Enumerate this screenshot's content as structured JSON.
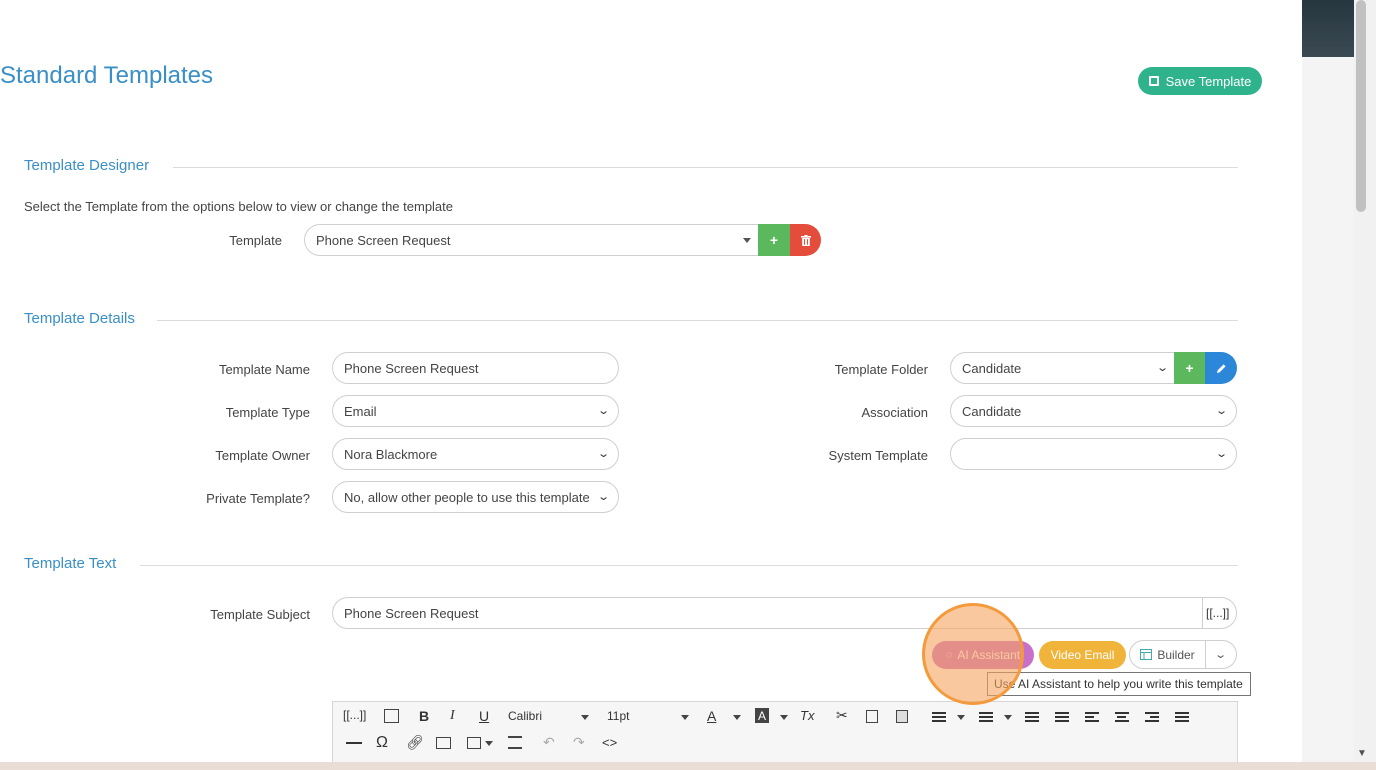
{
  "page": {
    "title": "Standard Templates",
    "save_label": "Save Template"
  },
  "sections": {
    "designer": "Template Designer",
    "details": "Template Details",
    "text": "Template Text"
  },
  "designer": {
    "hint": "Select the Template from the options below to view or change the template",
    "template_label": "Template",
    "template_value": "Phone Screen Request",
    "add_symbol": "+"
  },
  "details": {
    "name_label": "Template Name",
    "name_value": "Phone Screen Request",
    "type_label": "Template Type",
    "type_value": "Email",
    "owner_label": "Template Owner",
    "owner_value": "Nora Blackmore",
    "private_label": "Private Template?",
    "private_value": "No, allow other people to use this template",
    "folder_label": "Template Folder",
    "folder_value": "Candidate",
    "association_label": "Association",
    "association_value": "Candidate",
    "system_label": "System Template",
    "system_value": "",
    "add_symbol": "+"
  },
  "text": {
    "subject_label": "Template Subject",
    "subject_value": "Phone Screen Request",
    "merge_field_symbol": "[[...]]",
    "ai_label": "AI Assistant",
    "video_label": "Video Email",
    "builder_label": "Builder",
    "tooltip": "Use AI Assistant to help you write this template"
  },
  "editor": {
    "merge_symbol": "[[...]]",
    "font_value": "Calibri",
    "size_value": "11pt",
    "bold": "B",
    "italic": "I",
    "underline": "U",
    "text_color": "A",
    "bg_color": "A",
    "clear_format": "Tx",
    "special_char": "Ω",
    "source": "<>"
  },
  "colors": {
    "accent": "#3a8fc6",
    "save": "#2fb38c",
    "add": "#5cb85c",
    "delete": "#e44c3c",
    "edit": "#2d87d8",
    "ai": "#c86fc9",
    "video": "#f0b43a"
  }
}
